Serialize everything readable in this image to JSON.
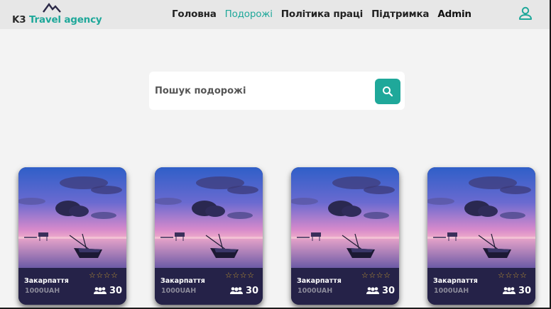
{
  "header": {
    "logo": {
      "prefix": "K3",
      "name": "Travel agency",
      "mark_icon": "mountains-icon"
    },
    "nav": [
      {
        "label": "Головна",
        "active": false
      },
      {
        "label": "Подорожі",
        "active": true
      },
      {
        "label": "Політика праці",
        "active": false
      },
      {
        "label": "Підтримка",
        "active": false
      },
      {
        "label": "Admin",
        "active": false
      }
    ],
    "user_icon": "user-icon"
  },
  "search": {
    "placeholder": "Пошук подорожі",
    "value": "",
    "button_icon": "search-icon"
  },
  "tours": [
    {
      "title": "Закарпаття",
      "price": "1000UAH",
      "rating": 0,
      "max_rating": 4,
      "capacity": "30",
      "stars": "☆☆☆☆"
    },
    {
      "title": "Закарпаття",
      "price": "1000UAH",
      "rating": 0,
      "max_rating": 4,
      "capacity": "30",
      "stars": "☆☆☆☆"
    },
    {
      "title": "Закарпаття",
      "price": "1000UAH",
      "rating": 0,
      "max_rating": 4,
      "capacity": "30",
      "stars": "☆☆☆☆"
    },
    {
      "title": "Закарпаття",
      "price": "1000UAH",
      "rating": 0,
      "max_rating": 4,
      "capacity": "30",
      "stars": "☆☆☆☆"
    }
  ],
  "colors": {
    "accent": "#1fa89a",
    "card_footer": "#252248",
    "star": "#c69a2e",
    "header_bg": "#e7e7e7",
    "page_bg": "#f3f3f3"
  }
}
